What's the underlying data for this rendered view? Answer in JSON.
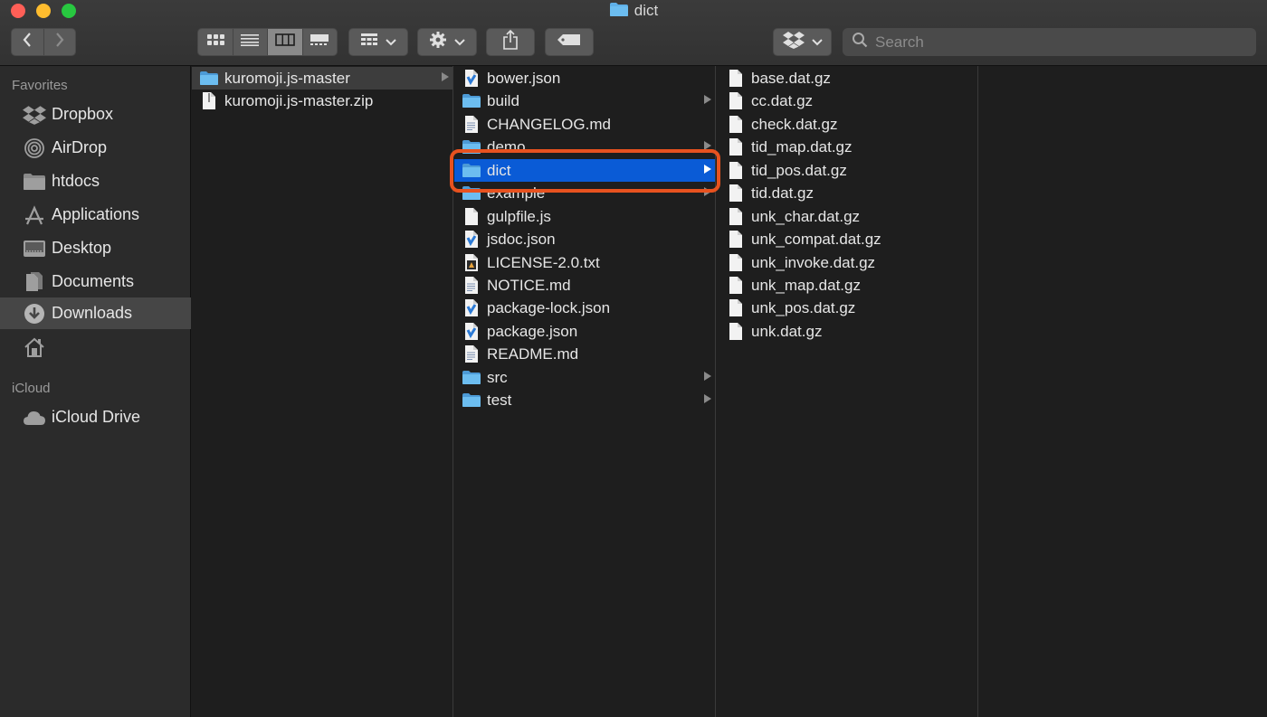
{
  "window": {
    "title": "dict"
  },
  "toolbar": {
    "back_icon": "chevron-left-icon",
    "forward_icon": "chevron-right-icon",
    "views": [
      "icon-view",
      "list-view",
      "column-view",
      "gallery-view"
    ],
    "active_view": "column-view",
    "search_placeholder": "Search"
  },
  "sidebar": {
    "favorites_label": "Favorites",
    "favorites": [
      {
        "label": "Dropbox",
        "icon": "dropbox-icon"
      },
      {
        "label": "AirDrop",
        "icon": "airdrop-icon"
      },
      {
        "label": "htdocs",
        "icon": "folder-icon"
      },
      {
        "label": "Applications",
        "icon": "applications-icon"
      },
      {
        "label": "Desktop",
        "icon": "desktop-icon"
      },
      {
        "label": "Documents",
        "icon": "documents-icon"
      },
      {
        "label": "Downloads",
        "icon": "downloads-icon",
        "selected": true
      },
      {
        "label": "",
        "icon": "home-icon"
      }
    ],
    "icloud_label": "iCloud",
    "icloud": [
      {
        "label": "iCloud Drive",
        "icon": "cloud-icon"
      }
    ]
  },
  "columns": {
    "col1": [
      {
        "name": "kuromoji.js-master",
        "type": "folder",
        "state": "path"
      },
      {
        "name": "kuromoji.js-master.zip",
        "type": "file"
      }
    ],
    "col2": [
      {
        "name": "bower.json",
        "type": "json"
      },
      {
        "name": "build",
        "type": "folder"
      },
      {
        "name": "CHANGELOG.md",
        "type": "doc"
      },
      {
        "name": "demo",
        "type": "folder"
      },
      {
        "name": "dict",
        "type": "folder",
        "state": "selected"
      },
      {
        "name": "example",
        "type": "folder"
      },
      {
        "name": "gulpfile.js",
        "type": "file"
      },
      {
        "name": "jsdoc.json",
        "type": "json"
      },
      {
        "name": "LICENSE-2.0.txt",
        "type": "txt"
      },
      {
        "name": "NOTICE.md",
        "type": "doc"
      },
      {
        "name": "package-lock.json",
        "type": "json"
      },
      {
        "name": "package.json",
        "type": "json"
      },
      {
        "name": "README.md",
        "type": "doc"
      },
      {
        "name": "src",
        "type": "folder"
      },
      {
        "name": "test",
        "type": "folder"
      }
    ],
    "col3": [
      {
        "name": "base.dat.gz",
        "type": "file"
      },
      {
        "name": "cc.dat.gz",
        "type": "file"
      },
      {
        "name": "check.dat.gz",
        "type": "file"
      },
      {
        "name": "tid_map.dat.gz",
        "type": "file"
      },
      {
        "name": "tid_pos.dat.gz",
        "type": "file"
      },
      {
        "name": "tid.dat.gz",
        "type": "file"
      },
      {
        "name": "unk_char.dat.gz",
        "type": "file"
      },
      {
        "name": "unk_compat.dat.gz",
        "type": "file"
      },
      {
        "name": "unk_invoke.dat.gz",
        "type": "file"
      },
      {
        "name": "unk_map.dat.gz",
        "type": "file"
      },
      {
        "name": "unk_pos.dat.gz",
        "type": "file"
      },
      {
        "name": "unk.dat.gz",
        "type": "file"
      }
    ]
  },
  "colors": {
    "selection": "#0a5bd6",
    "highlight_ring": "#e8521f",
    "folder": "#5fb0e8"
  }
}
